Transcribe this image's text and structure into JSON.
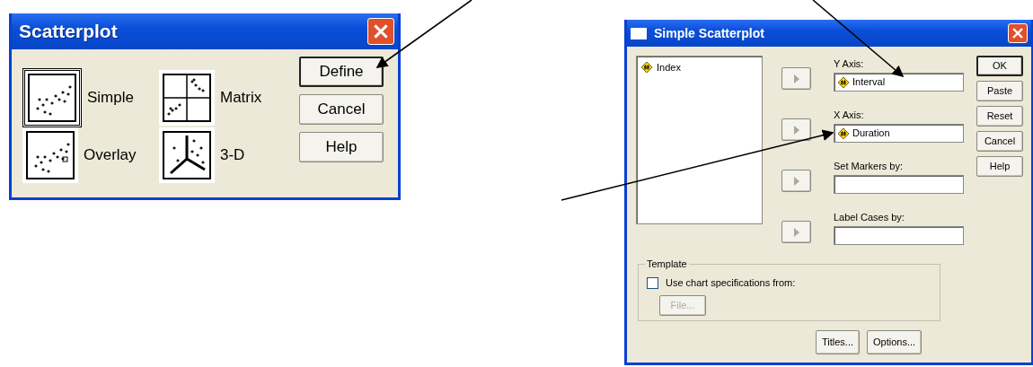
{
  "scatterplot_dialog": {
    "title": "Scatterplot",
    "options": [
      {
        "label": "Simple",
        "kind": "simple",
        "selected": true
      },
      {
        "label": "Overlay",
        "kind": "overlay",
        "selected": false
      },
      {
        "label": "Matrix",
        "kind": "matrix",
        "selected": false
      },
      {
        "label": "3-D",
        "kind": "threed",
        "selected": false
      }
    ],
    "buttons": [
      {
        "label": "Define",
        "default": true
      },
      {
        "label": "Cancel",
        "default": false
      },
      {
        "label": "Help",
        "default": false
      }
    ]
  },
  "simple_scatterplot_dialog": {
    "title": "Simple Scatterplot",
    "variables": [
      {
        "label": "Index"
      }
    ],
    "targets": [
      {
        "label": "Y Axis:",
        "value": "Interval"
      },
      {
        "label": "X Axis:",
        "value": "Duration"
      },
      {
        "label": "Set Markers by:"
      },
      {
        "label": "Label Cases by:"
      }
    ],
    "buttons": [
      {
        "label": "OK",
        "default": true
      },
      {
        "label": "Paste",
        "default": false
      },
      {
        "label": "Reset",
        "default": false
      },
      {
        "label": "Cancel",
        "default": false
      },
      {
        "label": "Help",
        "default": false
      }
    ],
    "template": {
      "legend": "Template",
      "checkbox": {
        "label": "Use chart specifications from:",
        "checked": false
      },
      "file_button": {
        "label": "File...",
        "disabled": true
      }
    },
    "bottom_buttons": [
      "Titles...",
      "Options..."
    ]
  }
}
